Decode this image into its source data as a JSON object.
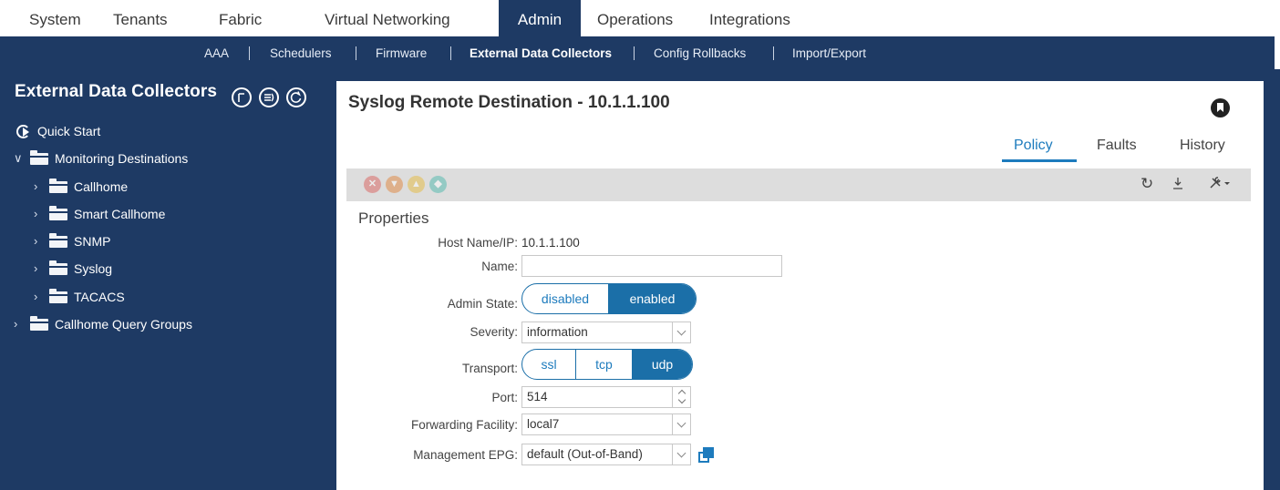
{
  "top_nav": {
    "tabs": [
      "System",
      "Tenants",
      "Fabric",
      "Virtual Networking",
      "Admin",
      "Operations",
      "Integrations"
    ],
    "active": "Admin"
  },
  "sub_nav": {
    "items": [
      "AAA",
      "Schedulers",
      "Firmware",
      "External Data Collectors",
      "Config Rollbacks",
      "Import/Export"
    ],
    "active": "External Data Collectors"
  },
  "sidebar": {
    "title": "External Data Collectors",
    "header_icons": [
      "flow-icon",
      "list-icon",
      "refresh-icon"
    ],
    "tree": [
      {
        "label": "Quick Start",
        "icon": "quick-start-icon"
      },
      {
        "label": "Monitoring Destinations",
        "icon": "folder-icon",
        "expanded": true
      },
      {
        "label": "Callhome",
        "icon": "folder-icon"
      },
      {
        "label": "Smart Callhome",
        "icon": "folder-icon"
      },
      {
        "label": "SNMP",
        "icon": "folder-icon"
      },
      {
        "label": "Syslog",
        "icon": "folder-icon"
      },
      {
        "label": "TACACS",
        "icon": "folder-icon"
      },
      {
        "label": "Callhome Query Groups",
        "icon": "folder-icon"
      }
    ]
  },
  "panel": {
    "title": "Syslog Remote Destination - 10.1.1.100",
    "tabs": [
      "Policy",
      "Faults",
      "History"
    ],
    "active_tab": "Policy",
    "fault_colors": [
      "#d9534f",
      "#e07b2a",
      "#e8b62b",
      "#3cb4a6"
    ],
    "toolbar_icons": [
      "refresh-icon",
      "download-icon",
      "tools-icon"
    ]
  },
  "properties": {
    "heading": "Properties",
    "host_label": "Host Name/IP:",
    "host_value": "10.1.1.100",
    "name_label": "Name:",
    "name_value": "",
    "admin_state_label": "Admin State:",
    "admin_state_options": [
      "disabled",
      "enabled"
    ],
    "admin_state_selected": "enabled",
    "severity_label": "Severity:",
    "severity_value": "information",
    "transport_label": "Transport:",
    "transport_options": [
      "ssl",
      "tcp",
      "udp"
    ],
    "transport_selected": "udp",
    "port_label": "Port:",
    "port_value": "514",
    "facility_label": "Forwarding Facility:",
    "facility_value": "local7",
    "epg_label": "Management EPG:",
    "epg_value": "default (Out-of-Band)"
  }
}
